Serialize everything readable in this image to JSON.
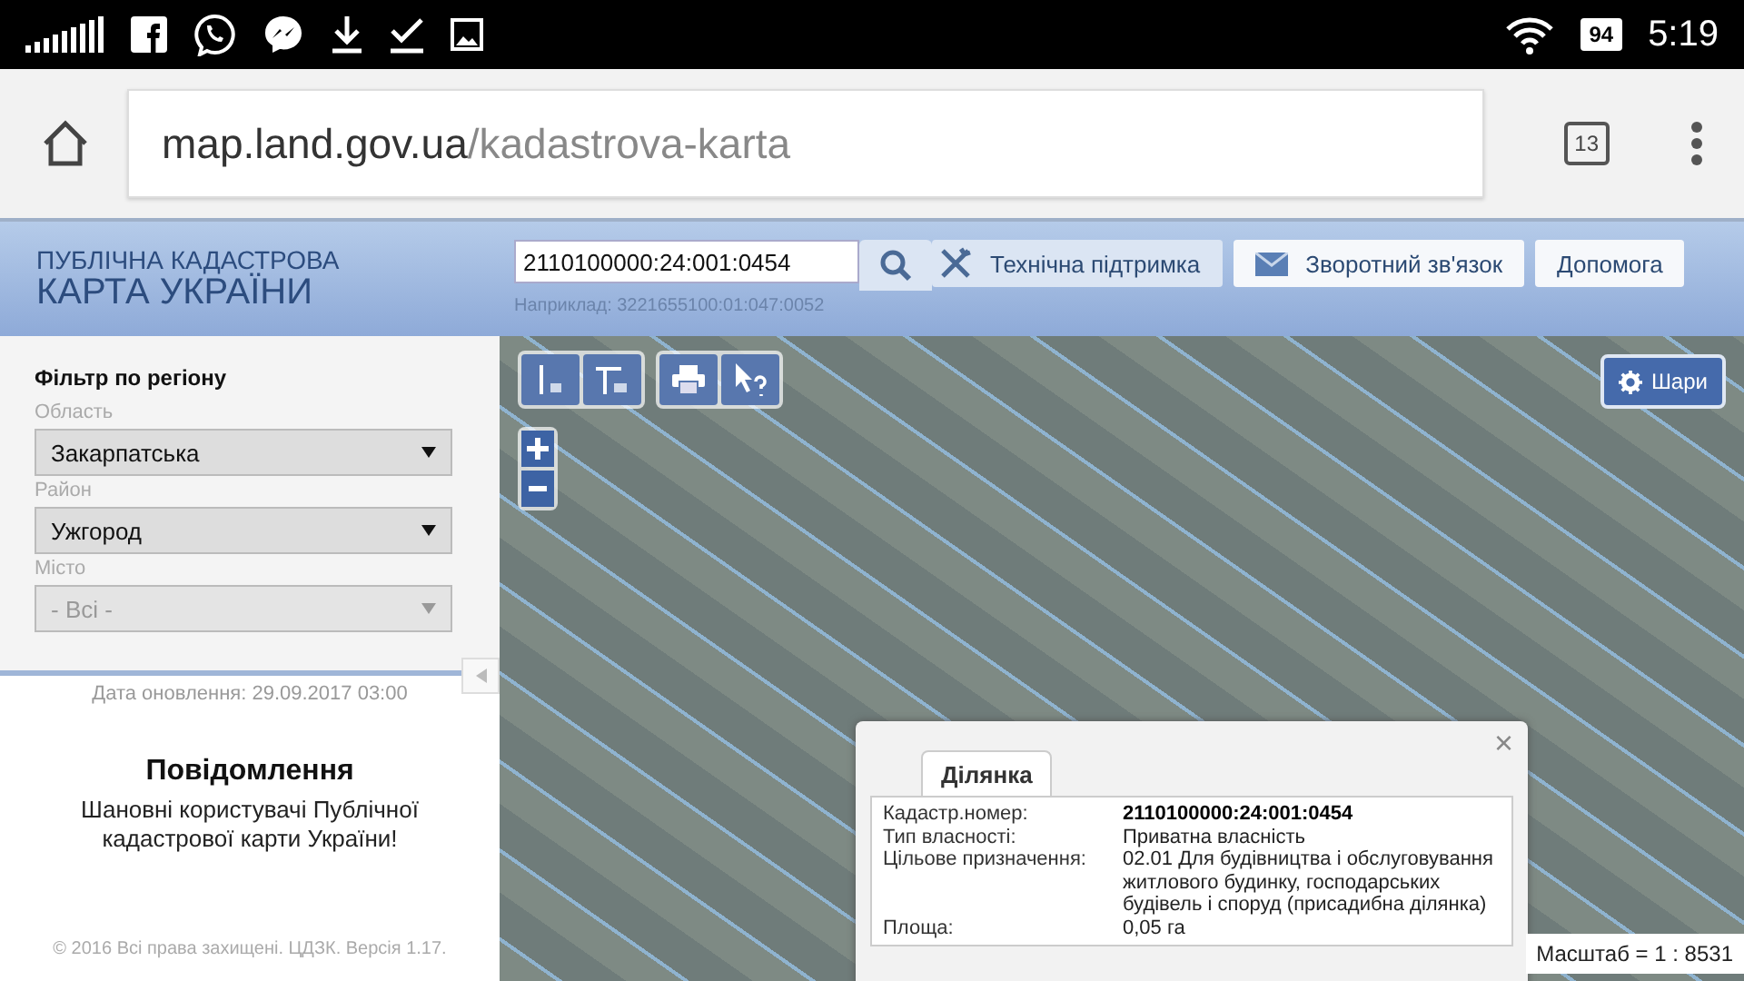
{
  "status_bar": {
    "battery": "94",
    "time": "5:19"
  },
  "browser": {
    "url_host": "map.land.gov.ua",
    "url_path": "/kadastrova-karta",
    "tab_count": "13"
  },
  "header": {
    "logo_line_1": "ПУБЛІЧНА КАДАСТРОВА",
    "logo_line_2": "КАРТА УКРАЇНИ",
    "search_value": "2110100000:24:001:0454",
    "search_hint": "Наприклад: 3221655100:01:047:0052",
    "buttons": [
      {
        "kind": "tools",
        "label": "Технічна підтримка"
      },
      {
        "kind": "mail",
        "label": "Зворотний зв'язок"
      },
      {
        "kind": "plain",
        "label": "Допомога"
      }
    ]
  },
  "sidebar": {
    "title": "Фільтр по регіону",
    "filters": [
      {
        "label": "Область",
        "value": "Закарпатська",
        "disabled": false
      },
      {
        "label": "Район",
        "value": "Ужгород",
        "disabled": false
      },
      {
        "label": "Місто",
        "value": "- Всі -",
        "disabled": true
      }
    ],
    "updated": "Дата оновлення: 29.09.2017 03:00",
    "notice_title": "Повідомлення",
    "notice_text": "Шановні користувачі Публічної кадастрової карти України!",
    "footer": "© 2016 Всі права захищені. ЦДЗК. Версія 1.17."
  },
  "map": {
    "layers_button": "Шари",
    "scale": "Масштаб = 1 : 8531",
    "popup": {
      "close": "×",
      "tabs": [
        {
          "label": "Ділянка",
          "selected": true
        }
      ],
      "rows": [
        {
          "label": "Кадастр.номер:",
          "value": "2110100000:24:001:0454",
          "bold": true
        },
        {
          "label": "Тип власності:",
          "value": "Приватна власність",
          "bold": false
        },
        {
          "label": "Цільове призначення:",
          "value": "02.01 Для будівництва і обслуговування житлового будинку, господарських будівель і споруд (присадибна ділянка)",
          "bold": false
        },
        {
          "label": "Площа:",
          "value": "0,05 га",
          "bold": false
        }
      ]
    }
  }
}
